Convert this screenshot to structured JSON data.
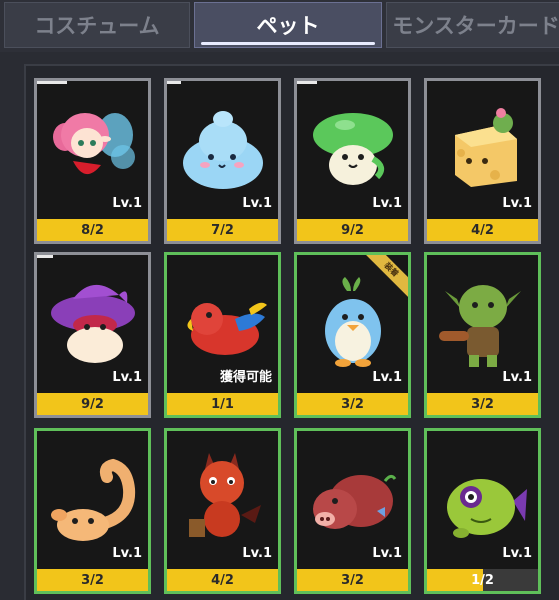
{
  "tabs": [
    {
      "label": "コスチューム",
      "active": false
    },
    {
      "label": "ペット",
      "active": true
    },
    {
      "label": "モンスターカード",
      "active": false
    }
  ],
  "pets": [
    {
      "name": "fairy",
      "level": "Lv.1",
      "count": "8/2",
      "border": "gray",
      "icon": "fairy-icon"
    },
    {
      "name": "slime",
      "level": "Lv.1",
      "count": "7/2",
      "border": "gray",
      "icon": "slime-icon"
    },
    {
      "name": "mushroom",
      "level": "Lv.1",
      "count": "9/2",
      "border": "gray",
      "icon": "mushroom-icon"
    },
    {
      "name": "cheese-cube",
      "level": "Lv.1",
      "count": "4/2",
      "border": "gray",
      "icon": "cheese-cube-icon"
    },
    {
      "name": "purple-mushroom",
      "level": "Lv.1",
      "count": "9/2",
      "border": "gray",
      "icon": "purple-mushroom-icon"
    },
    {
      "name": "parrot",
      "level": "",
      "status": "獲得可能",
      "count": "1/1",
      "border": "green",
      "icon": "parrot-icon"
    },
    {
      "name": "penguin",
      "level": "Lv.1",
      "count": "3/2",
      "border": "green",
      "icon": "penguin-icon",
      "ribbon": "装着"
    },
    {
      "name": "goblin",
      "level": "Lv.1",
      "count": "3/2",
      "border": "green",
      "icon": "goblin-icon"
    },
    {
      "name": "scorpion",
      "level": "Lv.1",
      "count": "3/2",
      "border": "green",
      "icon": "scorpion-icon"
    },
    {
      "name": "imp",
      "level": "Lv.1",
      "count": "4/2",
      "border": "green",
      "icon": "imp-icon"
    },
    {
      "name": "boar",
      "level": "Lv.1",
      "count": "3/2",
      "border": "green",
      "icon": "boar-icon"
    },
    {
      "name": "fish",
      "level": "Lv.1",
      "count": "1/2",
      "progress": 0.5,
      "border": "green",
      "icon": "fish-icon"
    }
  ],
  "colors": {
    "gold": "#f2c51a",
    "green": "#5fbf5a",
    "gray": "#8d8f96"
  }
}
